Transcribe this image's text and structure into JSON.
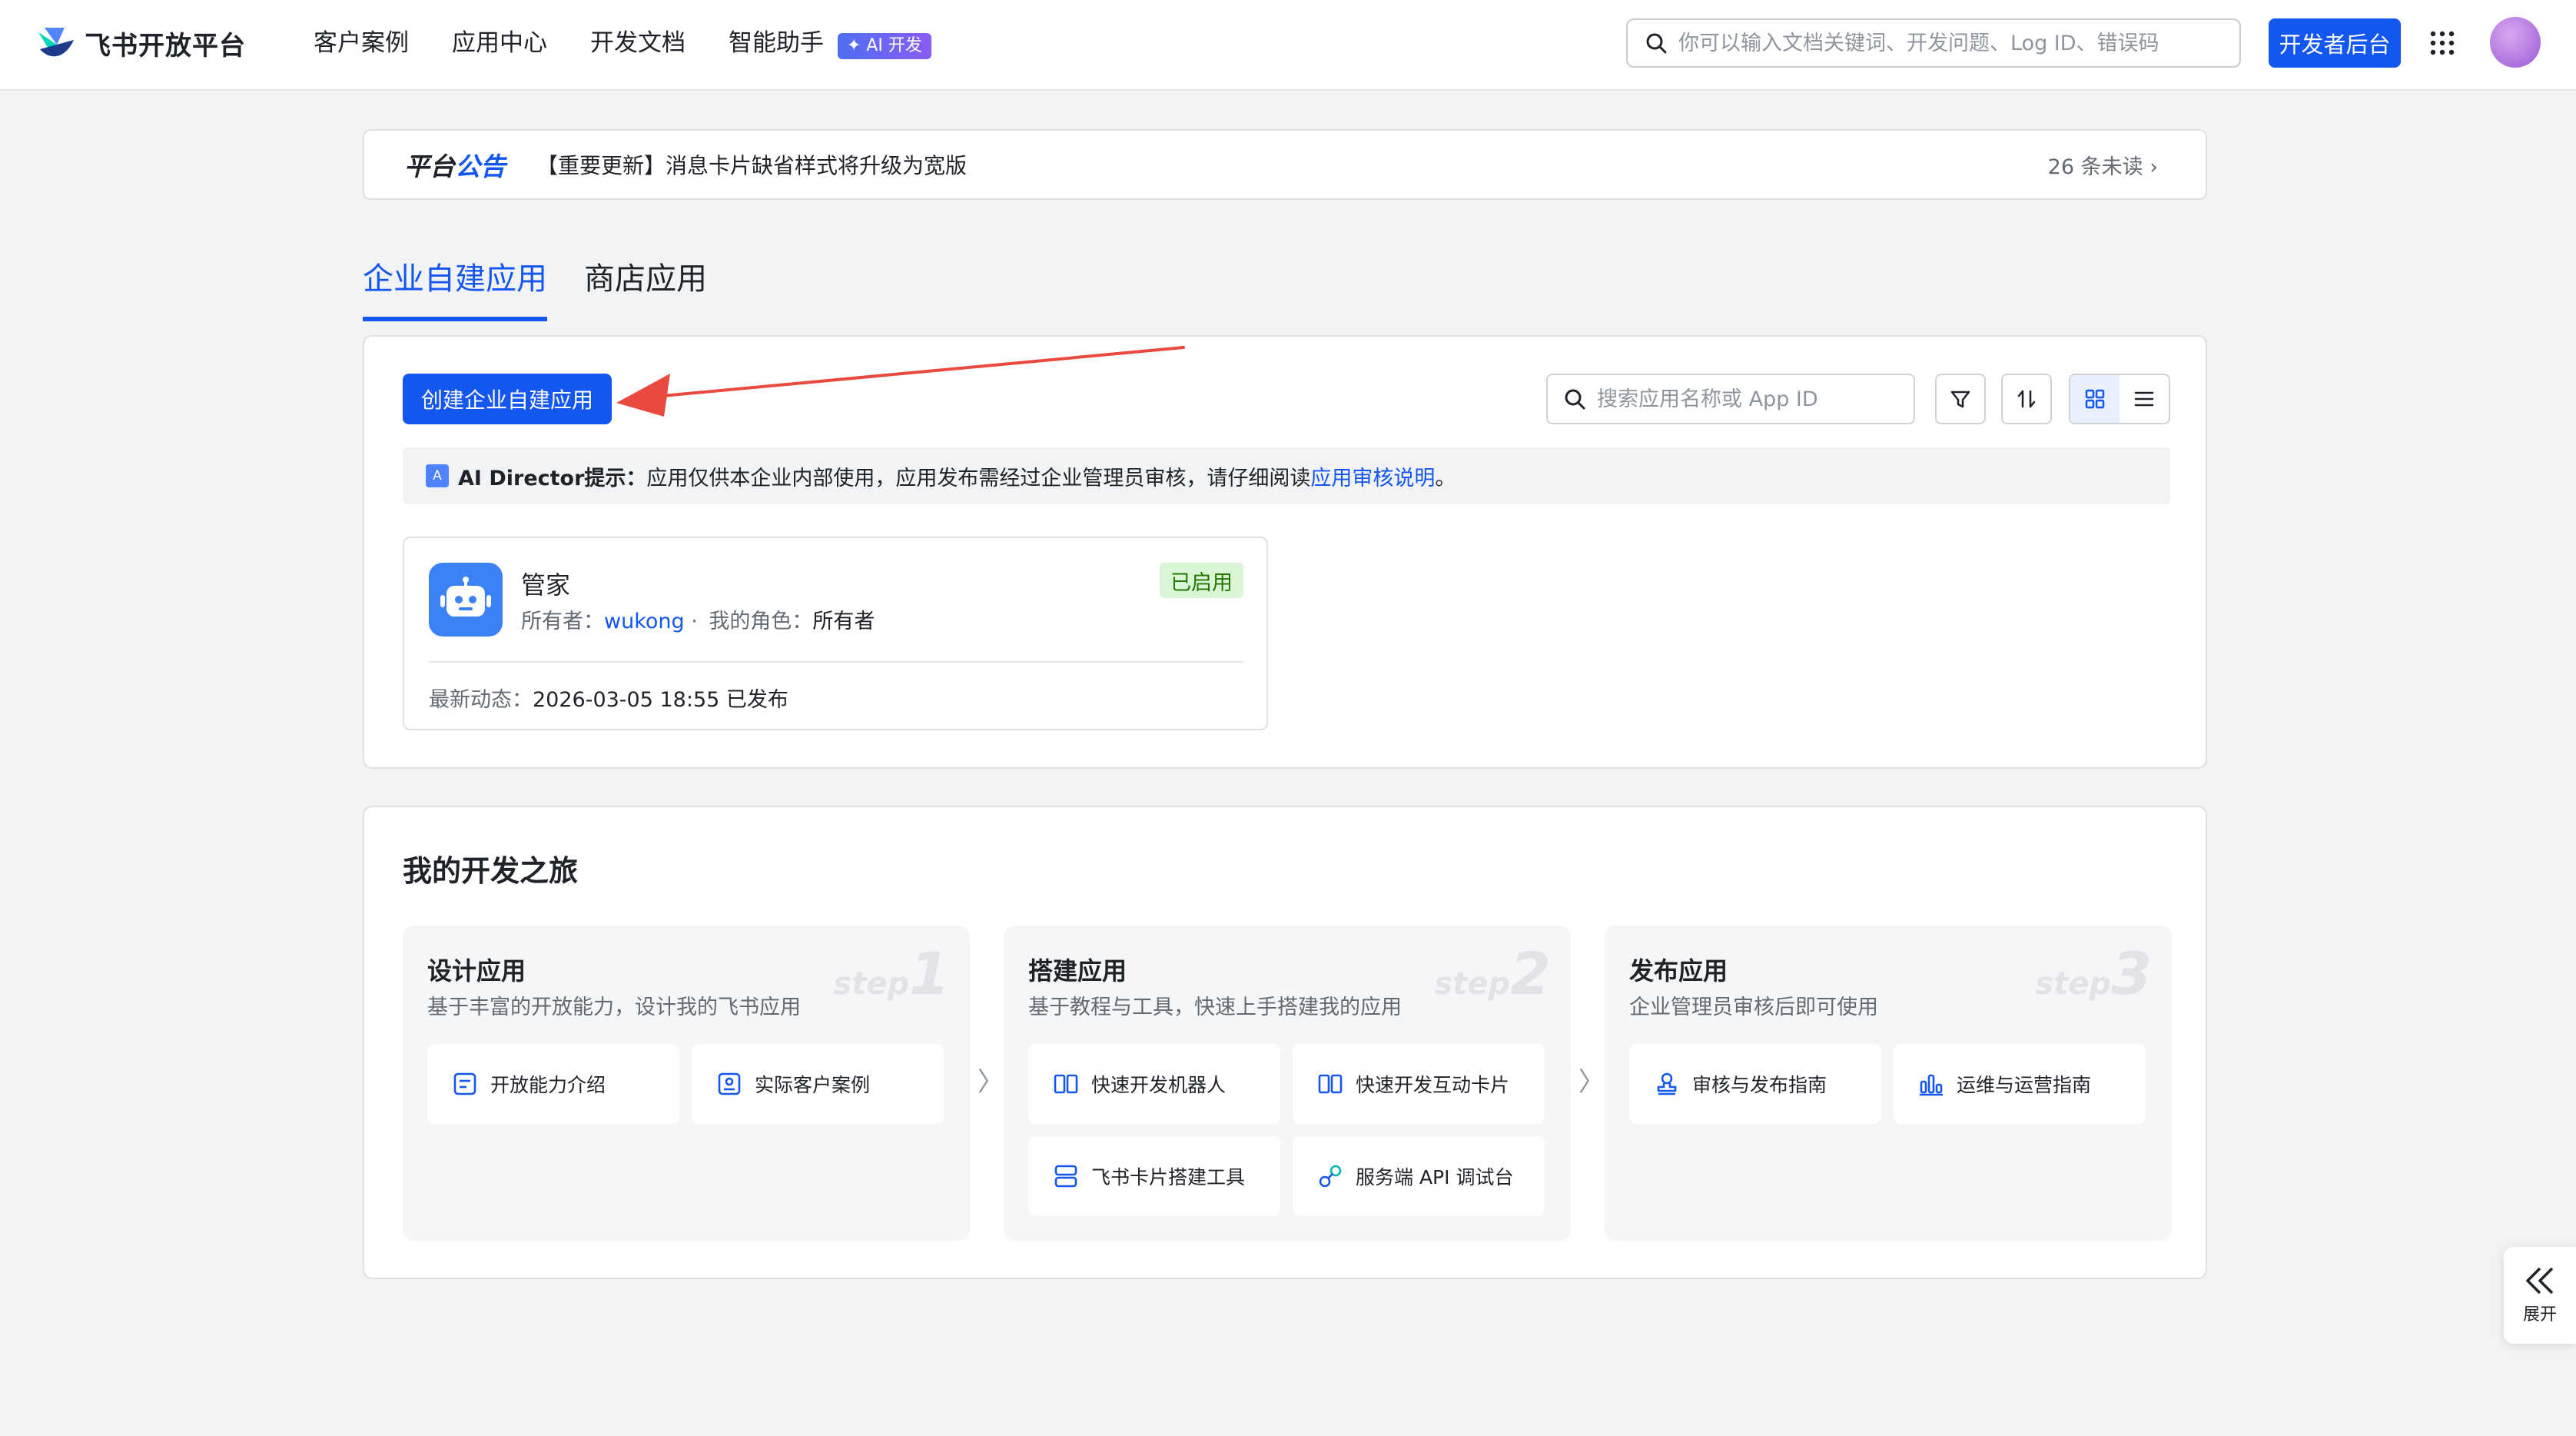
{
  "header": {
    "logo_text": "飞书开放平台",
    "nav": [
      "客户案例",
      "应用中心",
      "开发文档",
      "智能助手"
    ],
    "ai_badge": "✦ AI 开发",
    "search_placeholder": "你可以输入文档关键词、开发问题、Log ID、错误码",
    "dev_button": "开发者后台"
  },
  "announcement": {
    "label_part1": "平台",
    "label_part2": "公告",
    "text": "【重要更新】消息卡片缺省样式将升级为宽版",
    "unread": "26 条未读 ›"
  },
  "tabs": [
    "企业自建应用",
    "商店应用"
  ],
  "apps_panel": {
    "create_button": "创建企业自建应用",
    "search_placeholder": "搜索应用名称或 App ID",
    "tip_prefix": "AI Director提示：",
    "tip_text": "应用仅供本企业内部使用，应用发布需经过企业管理员审核，请仔细阅读 ",
    "tip_link": "应用审核说明",
    "tip_suffix": "。",
    "app": {
      "name": "管家",
      "status": "已启用",
      "owner_label": "所有者：",
      "owner": "wukong",
      "sep": " · ",
      "role_label": "我的角色：",
      "role": "所有者",
      "latest_label": "最新动态：",
      "latest_value": "2026-03-05 18:55 已发布"
    }
  },
  "journey": {
    "title": "我的开发之旅",
    "steps": [
      {
        "title": "设计应用",
        "desc": "基于丰富的开放能力，设计我的飞书应用",
        "mark": "step",
        "num": "1",
        "items": [
          "开放能力介绍",
          "实际客户案例"
        ]
      },
      {
        "title": "搭建应用",
        "desc": "基于教程与工具，快速上手搭建我的应用",
        "mark": "step",
        "num": "2",
        "items": [
          "快速开发机器人",
          "快速开发互动卡片",
          "飞书卡片搭建工具",
          "服务端 API 调试台"
        ]
      },
      {
        "title": "发布应用",
        "desc": "企业管理员审核后即可使用",
        "mark": "step",
        "num": "3",
        "items": [
          "审核与发布指南",
          "运维与运营指南"
        ]
      }
    ]
  },
  "side": {
    "expand_label": "展开"
  },
  "colors": {
    "primary": "#1456f0",
    "status_green": "#237804",
    "bg": "#f2f3f5"
  }
}
